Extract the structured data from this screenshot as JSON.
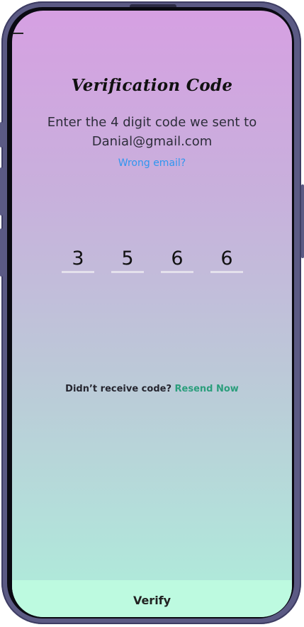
{
  "screen": {
    "title": "Verification Code",
    "subtitle_line1": "Enter the 4 digit code we sent to",
    "subtitle_line2": "Danial@gmail.com",
    "wrong_email_link": "Wrong email?",
    "code_digits": [
      "3",
      "5",
      "6",
      "6"
    ],
    "resend_prompt": "Didn’t receive code?",
    "resend_link": "Resend Now",
    "verify_button": "Verify"
  },
  "colors": {
    "gradient_top": "#d6a0e2",
    "gradient_bottom": "#aeeedb",
    "link_blue": "#2f96ef",
    "link_green": "#2b9e7c",
    "verify_bar": "#bdfae0"
  },
  "icons": {
    "back": "back-arrow-icon"
  }
}
